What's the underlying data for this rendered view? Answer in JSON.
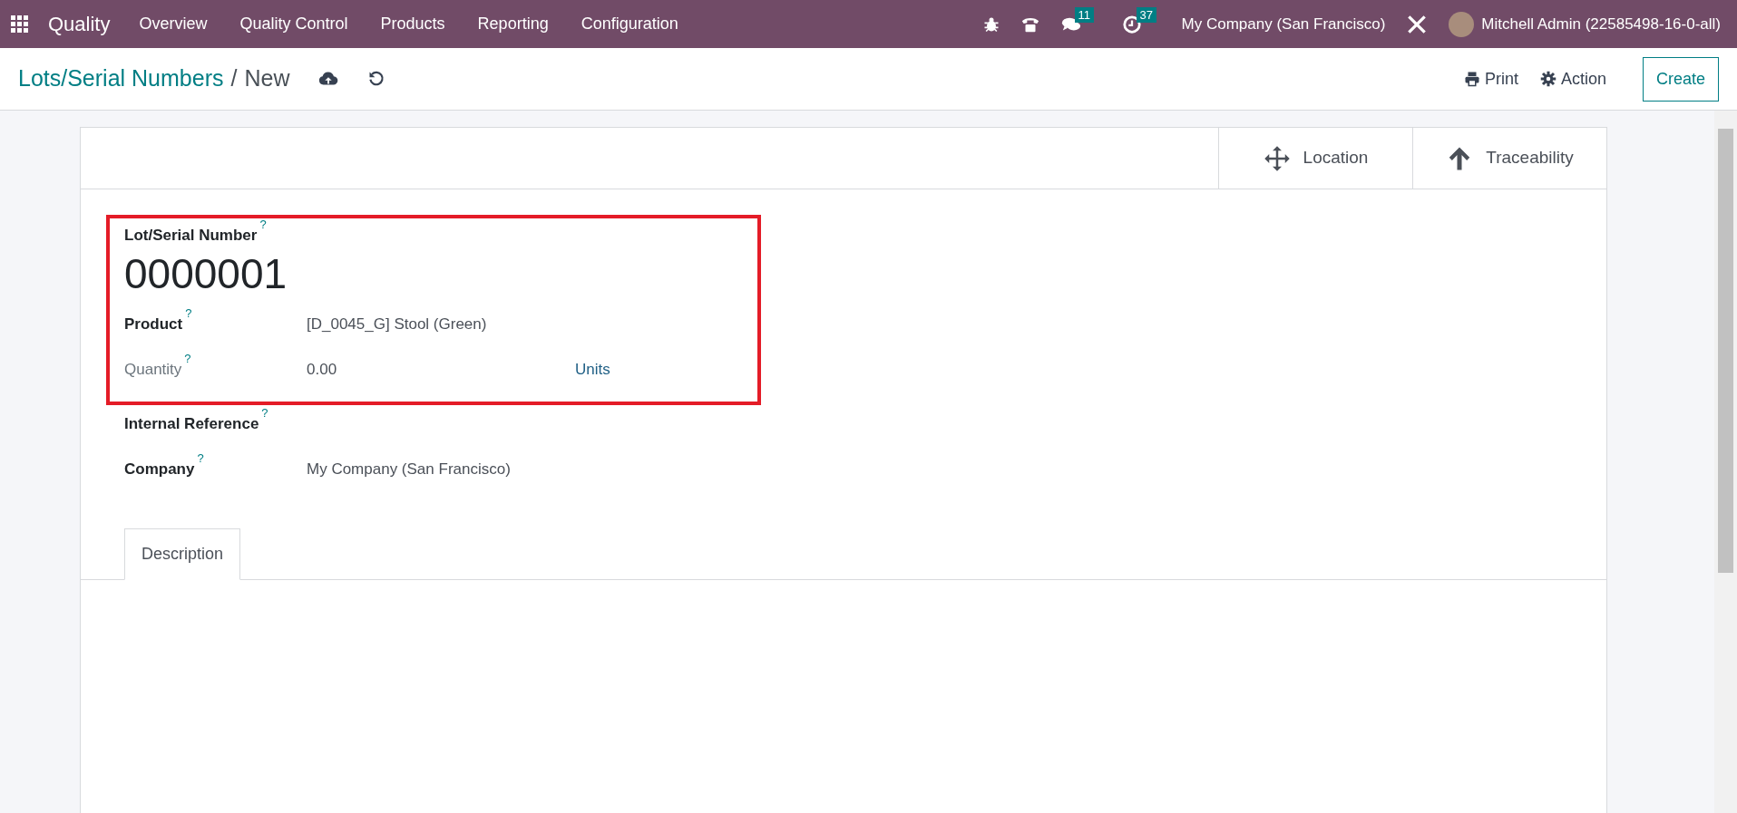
{
  "navbar": {
    "app_name": "Quality",
    "menu": [
      "Overview",
      "Quality Control",
      "Products",
      "Reporting",
      "Configuration"
    ],
    "messages_count": "11",
    "activities_count": "37",
    "company": "My Company (San Francisco)",
    "user": "Mitchell Admin (22585498-16-0-all)"
  },
  "breadcrumb": {
    "parent": "Lots/Serial Numbers",
    "separator": "/",
    "current": "New"
  },
  "actions": {
    "print": "Print",
    "action": "Action",
    "create": "Create"
  },
  "button_box": [
    {
      "kind": "move",
      "label": "Location"
    },
    {
      "kind": "up",
      "label": "Traceability"
    }
  ],
  "fields": [
    {
      "kind": "title",
      "label": "Lot/Serial Number",
      "value": "0000001",
      "readonly": false,
      "highlighted": true
    },
    {
      "kind": "text",
      "label": "Product",
      "value": "[D_0045_G] Stool (Green)",
      "readonly": false,
      "highlighted": true
    },
    {
      "kind": "quantity",
      "label": "Quantity",
      "value": "0.00",
      "unit": "Units",
      "readonly": true,
      "highlighted": true
    },
    {
      "kind": "text",
      "label": "Internal Reference",
      "readonly": false,
      "highlighted": false
    },
    {
      "kind": "text",
      "label": "Company",
      "value": "My Company (San Francisco)",
      "readonly": false,
      "highlighted": false
    }
  ],
  "help_mark": "?",
  "tabs": [
    {
      "label": "Description",
      "selected": true
    }
  ]
}
